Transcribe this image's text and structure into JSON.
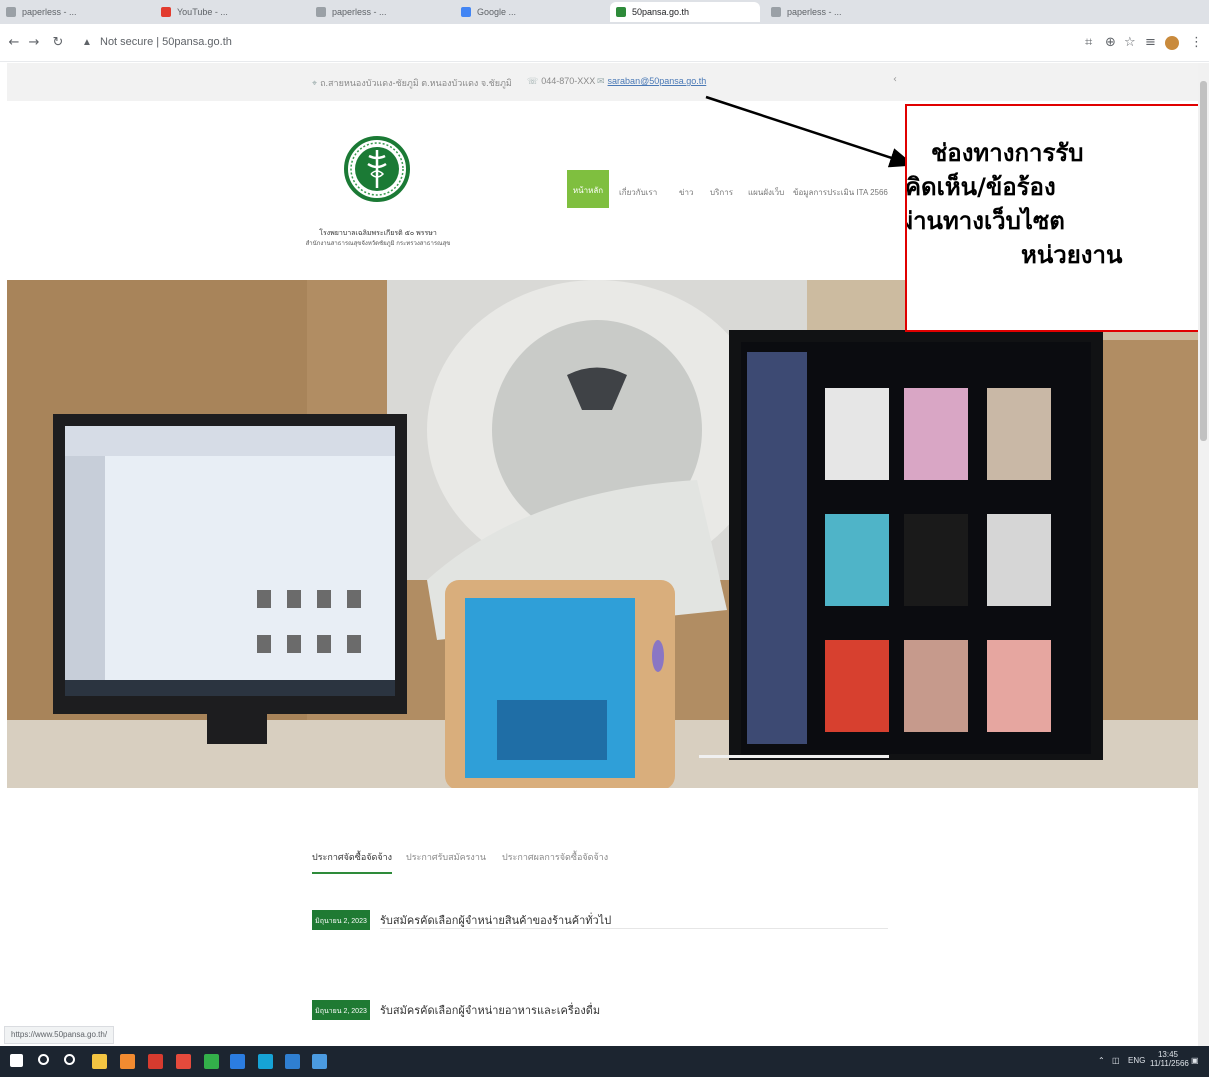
{
  "browser": {
    "tabs": [
      {
        "label": "paperless - ..."
      },
      {
        "label": "YouTube - ..."
      },
      {
        "label": "paperless - ..."
      },
      {
        "label": "Google ..."
      },
      {
        "label": "50pansa.go.th"
      },
      {
        "label": "paperless - ..."
      }
    ],
    "address": "Not secure | 50pansa.go.th",
    "lock_icon": "info-icon"
  },
  "infobar": {
    "address": "ถ.สายหนองบัวแดง-ชัยภูมิ ต.หนองบัวแดง จ.ชัยภูมิ",
    "phone": "044-870-XXX",
    "email": "saraban@50pansa.go.th"
  },
  "logo": {
    "line1": "โรงพยาบาลเฉลิมพระเกียรติ ๕๐ พรรษา",
    "line2": "สำนักงานสาธารณสุขจังหวัดชัยภูมิ กระทรวงสาธารณสุข"
  },
  "nav": {
    "home": "หน้าหลัก",
    "items": [
      "เกี่ยวกับเรา",
      "ข่าว",
      "บริการ",
      "แผนผังเว็บ",
      "ข้อมูลการประเมิน ITA 2566"
    ]
  },
  "callout": {
    "lines": [
      "ช่องทางการรับ",
      "คิดเห็น/ข้อร้อง",
      "ผ่านทางเว็บไซต",
      "หน่วยงาน"
    ]
  },
  "announcements": {
    "tabs": [
      "ประกาศจัดซื้อจัดจ้าง",
      "ประกาศรับสมัครงาน",
      "ประกาศผลการจัดซื้อจัดจ้าง"
    ],
    "items": [
      {
        "date": "มิถุนายน 2, 2023",
        "title": "รับสมัครคัดเลือกผู้จำหน่ายสินค้าของร้านค้าทั่วไป"
      },
      {
        "date": "มิถุนายน 2, 2023",
        "title": "รับสมัครคัดเลือกผู้จำหน่ายอาหารและเครื่องดื่ม"
      }
    ]
  },
  "status_url": "https://www.50pansa.go.th/",
  "taskbar": {
    "language": "ENG",
    "time": "13:45",
    "date": "11/11/2566"
  },
  "colors": {
    "nav_green": "#7fbf3f",
    "badge_green": "#1f7a33",
    "callout_border": "#e00000",
    "taskbar": "#1c2530"
  }
}
